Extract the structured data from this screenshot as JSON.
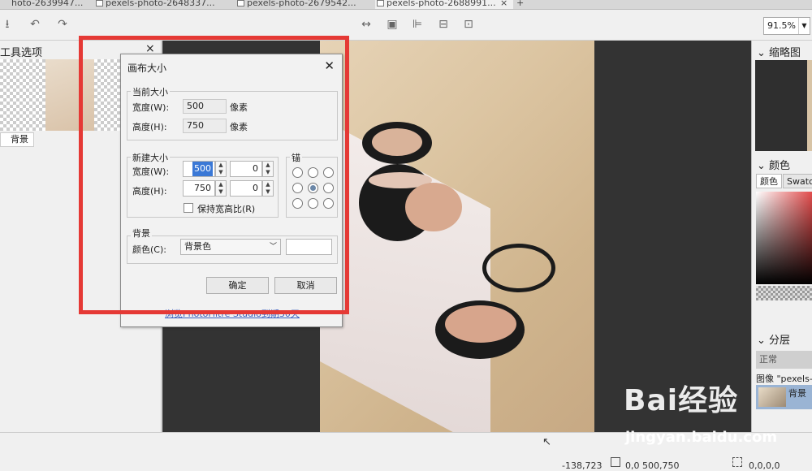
{
  "tabs": [
    {
      "label": "hoto-2639947..."
    },
    {
      "label": "pexels-photo-2648337..."
    },
    {
      "label": "pexels-photo-2679542..."
    },
    {
      "label": "pexels-photo-2688991..."
    }
  ],
  "tab_close": "×",
  "tab_add": "+",
  "toolbar": {
    "zoom": "91.5%"
  },
  "left_panel": {
    "title": "工具选项",
    "close": "×",
    "layer_label": "背景",
    "layer_prefix": "景"
  },
  "right_panel": {
    "thumbnail_title": "缩略图",
    "color_title": "颜色",
    "color_tabs": [
      "颜色",
      "Swatc"
    ],
    "layers_title": "分层",
    "blend_mode": "正常",
    "image_label": "图像 \"pexels-",
    "layer_name": "背景"
  },
  "dialog": {
    "title": "画布大小",
    "current_group": "当前大小",
    "width_label": "宽度(W):",
    "height_label": "高度(H):",
    "current_width": "500",
    "current_height": "750",
    "unit": "像素",
    "new_group": "新建大小",
    "new_width": "500",
    "new_height": "750",
    "offset_w": "0",
    "offset_h": "0",
    "keep_ratio": "保持宽高比(R)",
    "anchor_group": "锚",
    "bg_group": "背景",
    "color_label": "颜色(C):",
    "color_value": "背景色",
    "ok": "确定",
    "cancel": "取消",
    "link": "浏览PhotoFiltre Studio到期30天"
  },
  "status": {
    "cursor": "-138,723",
    "size": "0,0 500,750",
    "selection": "0,0,0,0"
  },
  "watermark": {
    "brand": "Bai经验",
    "url": "jingyan.baidu.com"
  }
}
